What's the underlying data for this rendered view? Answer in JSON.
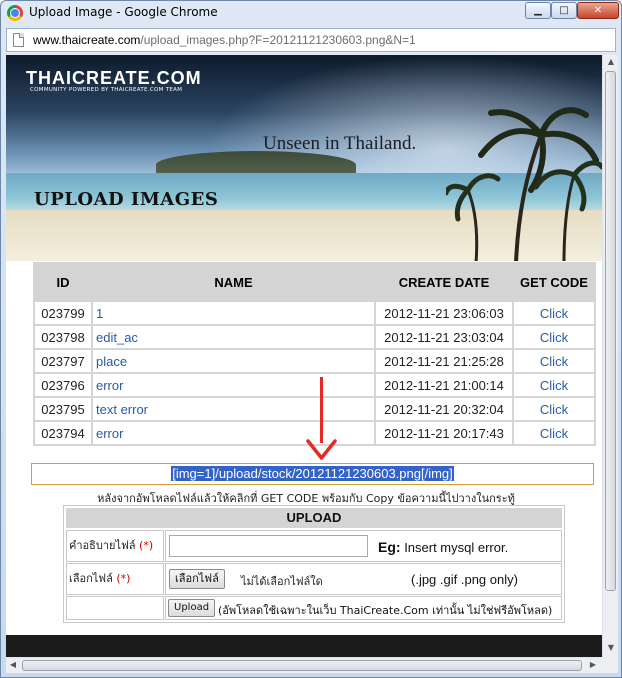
{
  "window": {
    "title": "Upload Image - Google Chrome",
    "url_host": "www.thaicreate.com",
    "url_path": "/upload_images.php?F=20121121230603.png&N=1",
    "controls": {
      "minimize": "▁",
      "maximize": "□",
      "close": "✕"
    }
  },
  "banner": {
    "logo": "THAICREATE.COM",
    "logo_sub": "COMMUNITY POWERED BY THAICREATE.COM TEAM",
    "tagline": "Unseen in Thailand.",
    "heading": "UPLOAD IMAGES"
  },
  "table": {
    "headers": {
      "id": "ID",
      "name": "NAME",
      "create_date": "CREATE DATE",
      "get_code": "GET CODE"
    },
    "rows": [
      {
        "id": "023799",
        "name": "1",
        "date": "2012-11-21 23:06:03",
        "code": "Click"
      },
      {
        "id": "023798",
        "name": "edit_ac",
        "date": "2012-11-21 23:03:04",
        "code": "Click"
      },
      {
        "id": "023797",
        "name": "place",
        "date": "2012-11-21 21:25:28",
        "code": "Click"
      },
      {
        "id": "023796",
        "name": "error",
        "date": "2012-11-21 21:00:14",
        "code": "Click"
      },
      {
        "id": "023795",
        "name": "text error",
        "date": "2012-11-21 20:32:04",
        "code": "Click"
      },
      {
        "id": "023794",
        "name": "error",
        "date": "2012-11-21 20:17:43",
        "code": "Click"
      }
    ]
  },
  "code_box": {
    "value": "[img=1]/upload/stock/20121121230603.png[/img]"
  },
  "hint": "หลังจากอัพโหลดไฟล์แล้วให้คลิกที่ GET CODE พร้อมกับ Copy ข้อความนี้ไปวางในกระทู้",
  "upload_form": {
    "title": "UPLOAD",
    "desc_label": "คำอธิบายไฟล์",
    "required_mark": "(*)",
    "desc_value": "",
    "eg_label": "Eg:",
    "eg_text": "Insert mysql error.",
    "file_label": "เลือกไฟล์",
    "file_button": "เลือกไฟล์",
    "file_status": "ไม่ได้เลือกไฟล์ใด",
    "file_types": "(.jpg .gif .png only)",
    "upload_button": "Upload",
    "upload_note": "(อัพโหลดใช้เฉพาะในเว็บ ThaiCreate.Com เท่านั้น ไม่ใช่ฟรีอัพโหลด)"
  },
  "colors": {
    "link": "#2b5aa5",
    "arrow": "#e32a24",
    "selection": "#3263c9",
    "code_border": "#d99a3b"
  }
}
